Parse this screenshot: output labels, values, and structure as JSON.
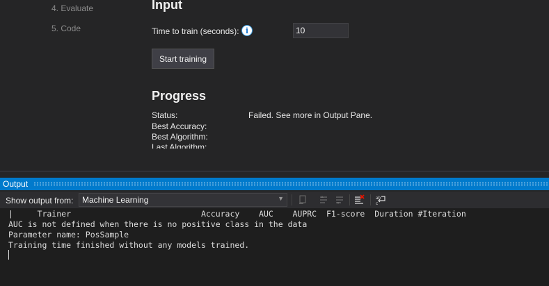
{
  "wizard_nav": {
    "steps": [
      {
        "label": "4. Evaluate"
      },
      {
        "label": "5. Code"
      }
    ]
  },
  "input_section": {
    "heading": "Input",
    "time_label": "Time to train (seconds):",
    "time_value": "10",
    "start_button": "Start training"
  },
  "progress_section": {
    "heading": "Progress",
    "status_label": "Status:",
    "status_value": "Failed. See more in Output Pane.",
    "best_accuracy_label": "Best Accuracy:",
    "best_algorithm_label": "Best Algorithm:",
    "last_algorithm_label": "Last Algorithm:"
  },
  "output_pane": {
    "title": "Output",
    "show_from_label": "Show output from:",
    "source_value": "Machine Learning",
    "lines": [
      "|     Trainer                           Accuracy    AUC    AUPRC  F1-score  Duration #Iteration",
      "AUC is not defined when there is no positive class in the data",
      "Parameter name: PosSample",
      "Training time finished without any models trained."
    ]
  },
  "colors": {
    "accent": "#007acc",
    "background": "#252526",
    "console_background": "#1e1e1e"
  }
}
